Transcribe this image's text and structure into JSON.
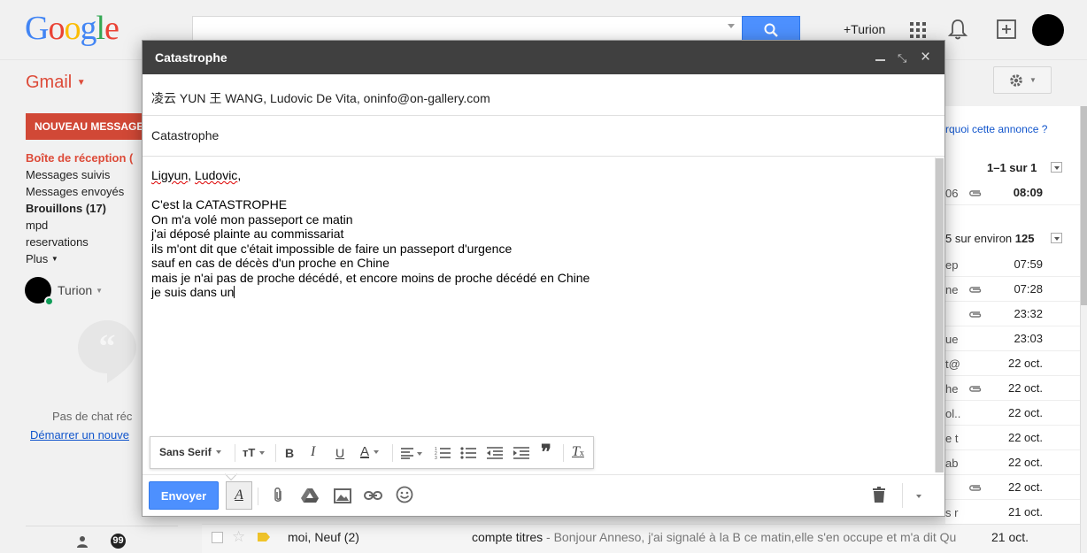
{
  "topbar": {
    "logo": "Google",
    "user_link": "+Turion"
  },
  "app": {
    "name": "Gmail"
  },
  "sidebar": {
    "compose_label": "NOUVEAU MESSAGE",
    "items": [
      {
        "label": "Boîte de réception ("
      },
      {
        "label": "Messages suivis"
      },
      {
        "label": "Messages envoyés"
      },
      {
        "label": "Brouillons (17)"
      },
      {
        "label": "mpd"
      },
      {
        "label": "reservations"
      },
      {
        "label": "Plus"
      }
    ],
    "hangout_user": "Turion",
    "chat_empty": "Pas de chat réc",
    "chat_start": "Démarrer un nouve"
  },
  "maillist": {
    "ad_link": "rquoi cette annonce ?",
    "pager_top": "1–1 sur 1",
    "pager_main_count": "5 sur environ ",
    "pager_main_total": "125",
    "top_row": {
      "frag": "06",
      "time": "08:09"
    },
    "rows": [
      {
        "frag": "ep",
        "clip": false,
        "time": "07:59"
      },
      {
        "frag": "ne",
        "clip": true,
        "time": "07:28"
      },
      {
        "frag": "",
        "clip": true,
        "time": "23:32"
      },
      {
        "frag": "ue",
        "clip": false,
        "time": "23:03"
      },
      {
        "frag": "t@",
        "clip": false,
        "time": "22 oct."
      },
      {
        "frag": "he",
        "clip": true,
        "time": "22 oct."
      },
      {
        "frag": "ol..",
        "clip": false,
        "time": "22 oct."
      },
      {
        "frag": "e t",
        "clip": false,
        "time": "22 oct."
      },
      {
        "frag": "ab",
        "clip": false,
        "time": "22 oct."
      },
      {
        "frag": "",
        "clip": true,
        "time": "22 oct."
      },
      {
        "frag": "s r",
        "clip": false,
        "time": "21 oct."
      }
    ],
    "bottom_row": {
      "sender": "moi, Neuf (2)",
      "subject": "compte titres",
      "snippet": " - Bonjour Anneso, j'ai signalé à la B ce matin,elle s'en occupe et m'a dit Qu",
      "time": "21 oct."
    }
  },
  "compose": {
    "title": "Catastrophe",
    "recipients": "凌云 YUN 王 WANG, Ludovic De Vita, oninfo@on-gallery.com",
    "subject": "Catastrophe",
    "greeting_name1": "Ligyun",
    "greeting_sep": ", ",
    "greeting_name2": "Ludovic",
    "greeting_end": ",",
    "body_lines": "C'est la CATASTROPHE\nOn m'a volé mon passeport ce matin\nj'ai déposé plainte au commissariat\nils m'ont dit que c'était impossible de faire un passeport d'urgence\nsauf en cas de décès d'un proche en Chine\nmais je n'ai pas de proche décédé, et encore moins de proche décédé en Chine\nje suis dans un",
    "font_name": "Sans Serif",
    "send_label": "Envoyer",
    "fmt_toggle_label": "A"
  },
  "colors": {
    "gmail_red": "#dd4b39",
    "compose_red": "#d14836",
    "blue_button": "#4d90fe",
    "header_dark": "#404040",
    "link_blue": "#1155cc"
  }
}
